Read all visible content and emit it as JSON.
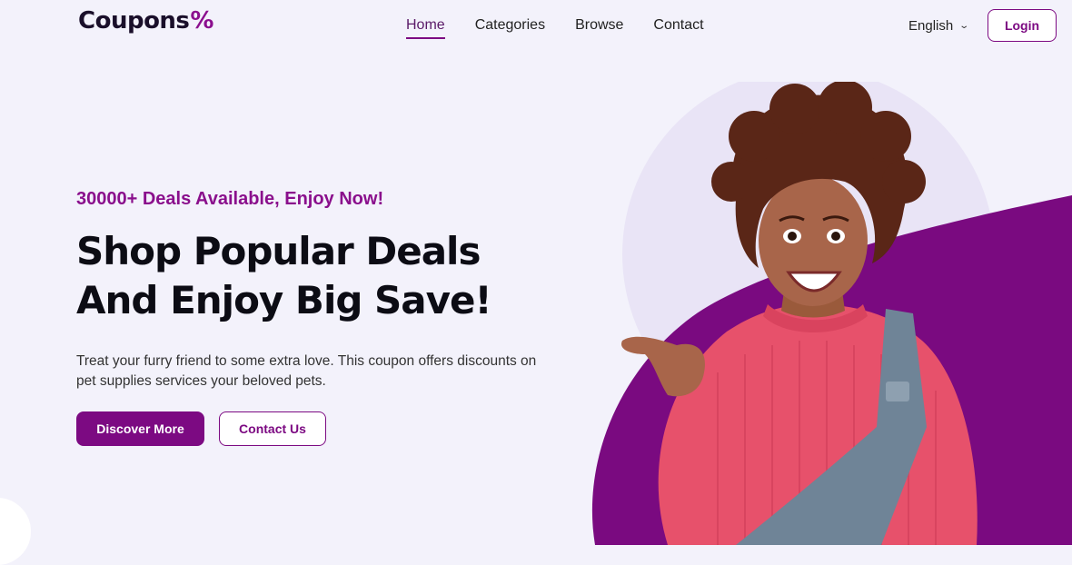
{
  "brand": {
    "name": "Coupons",
    "symbol": "%"
  },
  "nav": {
    "items": [
      {
        "label": "Home",
        "active": true
      },
      {
        "label": "Categories",
        "active": false
      },
      {
        "label": "Browse",
        "active": false
      },
      {
        "label": "Contact",
        "active": false
      }
    ]
  },
  "language": {
    "selected": "English"
  },
  "header": {
    "login_label": "Login"
  },
  "hero": {
    "tagline": "30000+ Deals Available, Enjoy Now!",
    "headline_line1": "Shop Popular Deals",
    "headline_line2": "And Enjoy Big Save!",
    "description": "Treat your furry friend to some extra love. This coupon offers discounts on pet supplies services your beloved pets.",
    "primary_button": "Discover More",
    "secondary_button": "Contact Us"
  },
  "colors": {
    "accent": "#7c0a82",
    "background": "#f3f2fb",
    "blob": "#7a0a80",
    "circle_bg": "#e9e4f6",
    "sweater": "#e7516b",
    "denim": "#6f8497"
  },
  "icons": {
    "language_dropdown": "chevron-down-icon"
  }
}
